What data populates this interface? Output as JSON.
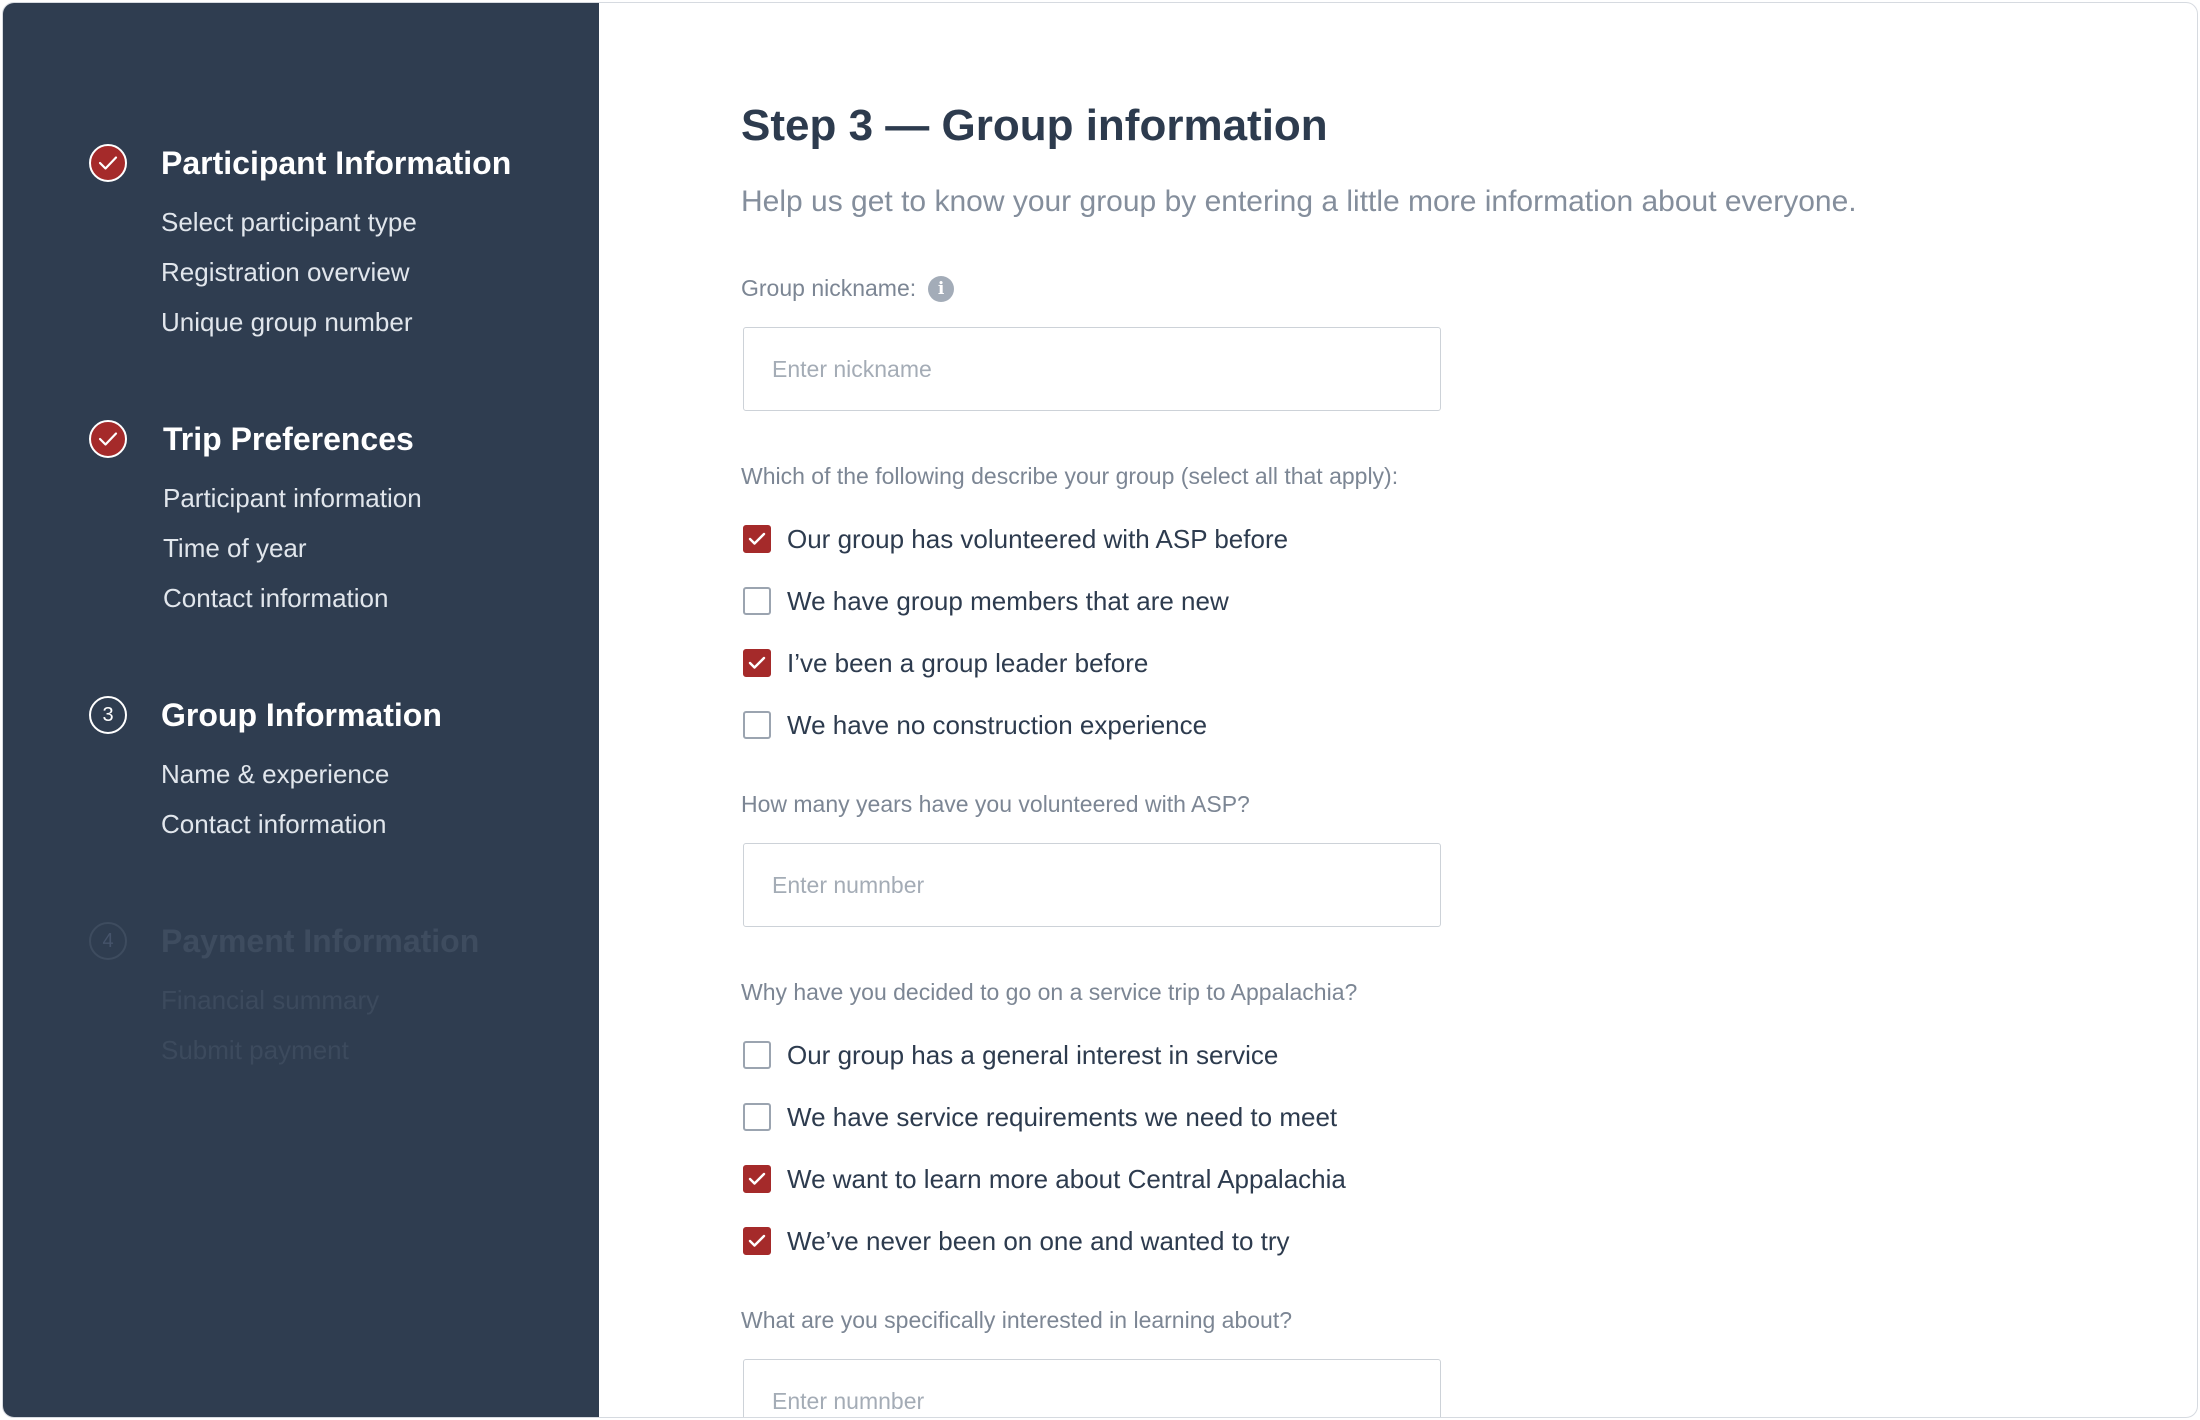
{
  "sidebar": {
    "sections": [
      {
        "title": "Participant Information",
        "status": "done",
        "items": [
          "Select participant type",
          "Registration overview",
          "Unique group number"
        ]
      },
      {
        "title": "Trip Preferences",
        "status": "done",
        "items": [
          "Participant information",
          "Time of year",
          "Contact information"
        ]
      },
      {
        "title": "Group Information",
        "status": "current",
        "number": "3",
        "items": [
          "Name & experience",
          "Contact information"
        ]
      },
      {
        "title": "Payment Information",
        "status": "future",
        "number": "4",
        "items": [
          "Financial summary",
          "Submit payment"
        ]
      }
    ]
  },
  "main": {
    "title": "Step 3 — Group information",
    "subtitle": "Help us get to know your group by entering a little more information about everyone.",
    "nickname": {
      "label": "Group nickname:",
      "placeholder": "Enter nickname",
      "value": ""
    },
    "describe": {
      "question": "Which of the following describe your group (select all that apply):",
      "options": [
        {
          "label": "Our group has volunteered with ASP before",
          "checked": true
        },
        {
          "label": "We have group members that are new",
          "checked": false
        },
        {
          "label": "I’ve been a group leader before",
          "checked": true
        },
        {
          "label": "We have no construction experience",
          "checked": false
        }
      ]
    },
    "years": {
      "label": "How many years have you volunteered with ASP?",
      "placeholder": "Enter numnber",
      "value": ""
    },
    "why": {
      "question": "Why have you decided to go on a service trip to Appalachia?",
      "options": [
        {
          "label": "Our group has a general interest in service",
          "checked": false
        },
        {
          "label": "We have service requirements we need to meet",
          "checked": false
        },
        {
          "label": "We want to learn more about Central Appalachia",
          "checked": true
        },
        {
          "label": "We’ve never been on one and wanted to try",
          "checked": true
        }
      ]
    },
    "interest": {
      "label": "What are you specifically interested in learning about?",
      "placeholder": "Enter numnber",
      "value": ""
    }
  },
  "colors": {
    "sidebar_bg": "#2f3d50",
    "accent": "#a52a2a",
    "heading": "#2d3b4e",
    "muted": "#848e9c"
  }
}
